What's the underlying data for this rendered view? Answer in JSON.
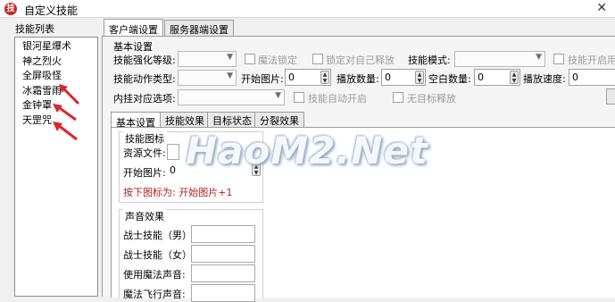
{
  "window": {
    "title": "自定义技能",
    "app_icon": "skill-app-icon",
    "close_glyph": "✕"
  },
  "skill_list": {
    "title": "技能列表",
    "items": [
      "银河星爆术",
      "神之烈火",
      "全屏吸怪",
      "冰霜雪雨",
      "金钟罩",
      "天罡咒"
    ]
  },
  "top_tabs": [
    {
      "label": "客户端设置",
      "active": true
    },
    {
      "label": "服务器端设置",
      "active": false
    }
  ],
  "basic": {
    "group_title": "基本设置",
    "skill_level_label": "技能强化等级:",
    "magic_lock_label": "魔法锁定",
    "self_lock_label": "锁定对自己释放",
    "skill_mode_label": "技能模式:",
    "skill_on_cast_label": "技能开启用后不",
    "action_type_label": "技能动作类型:",
    "start_image_label": "开始图片:",
    "start_image_value": "0",
    "play_count_label": "播放数量:",
    "play_count_value": "0",
    "blank_count_label": "空白数量:",
    "blank_count_value": "0",
    "play_speed_label": "播放速度:",
    "play_speed_value": "0",
    "hook_option_label": "内挂对应选项:",
    "auto_enable_label": "技能自动开启",
    "no_target_label": "无目标释放"
  },
  "sub_tabs": [
    {
      "label": "基本设置",
      "active": true
    },
    {
      "label": "技能效果",
      "active": false
    },
    {
      "label": "目标状态",
      "active": false
    },
    {
      "label": "分裂效果",
      "active": false
    }
  ],
  "icon_group": {
    "title": "技能图标",
    "resource_label": "资源文件:",
    "start_image_label": "开始图片:",
    "start_image_value": "0",
    "hint": "按下图标为: 开始图片+1"
  },
  "sound_group": {
    "title": "声音效果",
    "fields": [
      "战士技能（男）:",
      "战士技能（女）:",
      "使用魔法声音:",
      "魔法飞行声音:"
    ]
  },
  "watermark": "HaoM2.Net",
  "colors": {
    "arrow": "#d9262c",
    "hint_text": "#b22222"
  }
}
